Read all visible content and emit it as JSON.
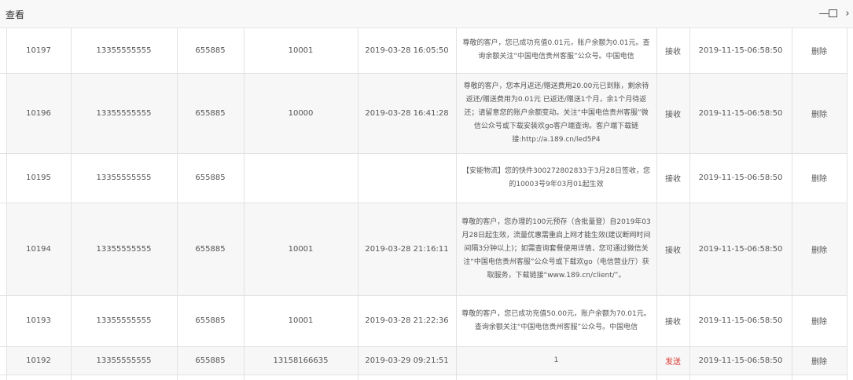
{
  "window": {
    "title": "查看",
    "controls": {
      "minimize": "—",
      "more": "›"
    }
  },
  "table": {
    "rows": [
      {
        "id": "10197",
        "phone": "13355555555",
        "code": "655885",
        "number": "10001",
        "time": "2019-03-28 16:05:50",
        "content": "尊敬的客户，您已成功充值0.01元，账户余额为0.01元。查询余额关注“中国电信贵州客服”公众号。中国电信",
        "type": "接收",
        "created": "2019-11-15-06:58:50",
        "action": "删除"
      },
      {
        "id": "10196",
        "phone": "13355555555",
        "code": "655885",
        "number": "10000",
        "time": "2019-03-28 16:41:28",
        "content": "尊敬的客户，您本月返还/赠送费用20.00元已到账，剩余待返还/赠送费用为0.01元 已返还/赠送1个月，余1个月待返还；请留意您的账户余额变动。关注“中国电信贵州客服”微信公众号或下载安装欢go客户端查询。客户端下载链接:http://a.189.cn/led5P4",
        "type": "接收",
        "created": "2019-11-15-06:58:50",
        "action": "删除"
      },
      {
        "id": "10195",
        "phone": "13355555555",
        "code": "655885",
        "number": "",
        "time": "",
        "content": "【安能物流】您的快件300272802833于3月28日签收，您的10003号9年03月01起生效",
        "type": "接收",
        "created": "2019-11-15-06:58:50",
        "action": "删除"
      },
      {
        "id": "10194",
        "phone": "13355555555",
        "code": "655885",
        "number": "10001",
        "time": "2019-03-28 21:16:11",
        "content": "尊敬的客户，您办理的100元预存（含批量登）自2019年03月28日起生效，流量优惠需重启上网才能生效(建议断网时间间隔3分钟以上)；如需查询套餐使用详情，您可通过微信关注“中国电信贵州客服”公众号或下载欢go（电信营业厅）获取服务，下载链接“www.189.cn/client/”。",
        "type": "接收",
        "created": "2019-11-15-06:58:50",
        "action": "删除"
      },
      {
        "id": "10193",
        "phone": "13355555555",
        "code": "655885",
        "number": "10001",
        "time": "2019-03-28 21:22:36",
        "content": "尊敬的客户，您已成功充值50.00元，账户余额为70.01元。查询余额关注“中国电信贵州客服”公众号。中国电信",
        "type": "接收",
        "created": "2019-11-15-06:58:50",
        "action": "删除"
      },
      {
        "id": "10192",
        "phone": "13355555555",
        "code": "655885",
        "number": "13158166635",
        "time": "2019-03-29 09:21:51",
        "content": "1",
        "type": "发送",
        "created": "2019-11-15-06:58:50",
        "action": "删除"
      }
    ]
  }
}
